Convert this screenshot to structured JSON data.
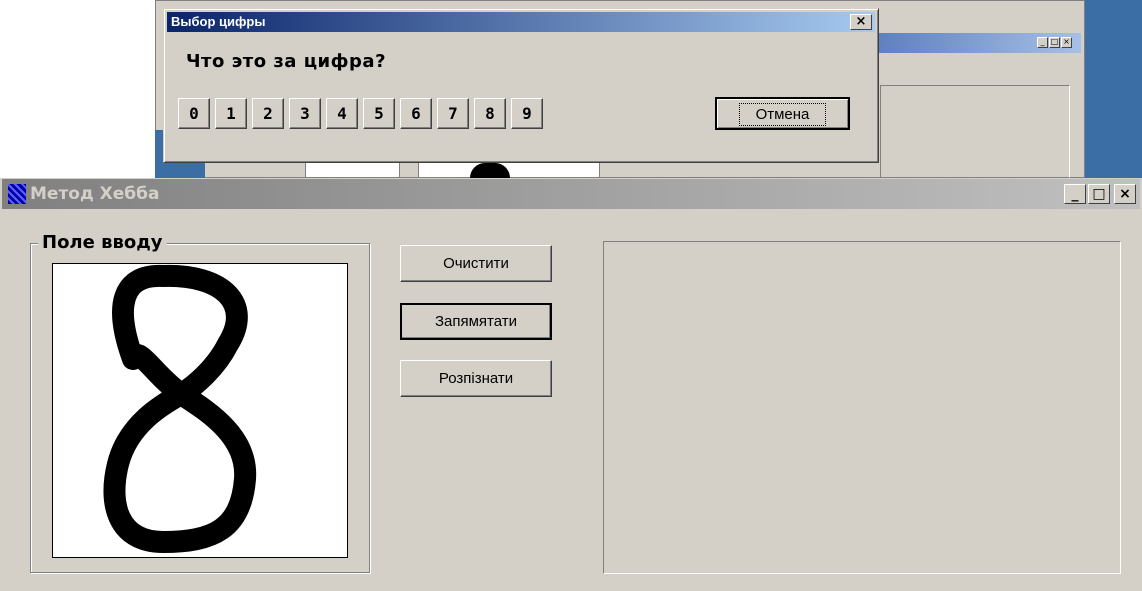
{
  "dialog": {
    "title": "Выбор цифры",
    "close_glyph": "×",
    "question": "Что это за цифра?",
    "digits": [
      "0",
      "1",
      "2",
      "3",
      "4",
      "5",
      "6",
      "7",
      "8",
      "9"
    ],
    "cancel_label": "Отмена"
  },
  "main_window": {
    "title": "Метод Хебба",
    "controls": {
      "minimize": "_",
      "maximize": "□",
      "close": "×"
    },
    "input_group_label": "Поле вводу",
    "buttons": {
      "clear": "Очистити",
      "memorize": "Запямятати",
      "recognize": "Розпізнати"
    },
    "drawn_digit": "8"
  },
  "background_window": {
    "controls": {
      "minimize": "_",
      "maximize": "□",
      "close": "×"
    }
  },
  "colors": {
    "face": "#d4d0c8",
    "active_title_start": "#0a246a",
    "active_title_end": "#a6caf0",
    "inactive_title_start": "#808080",
    "inactive_title_end": "#c0c0c0",
    "desktop": "#3a6ea5"
  }
}
